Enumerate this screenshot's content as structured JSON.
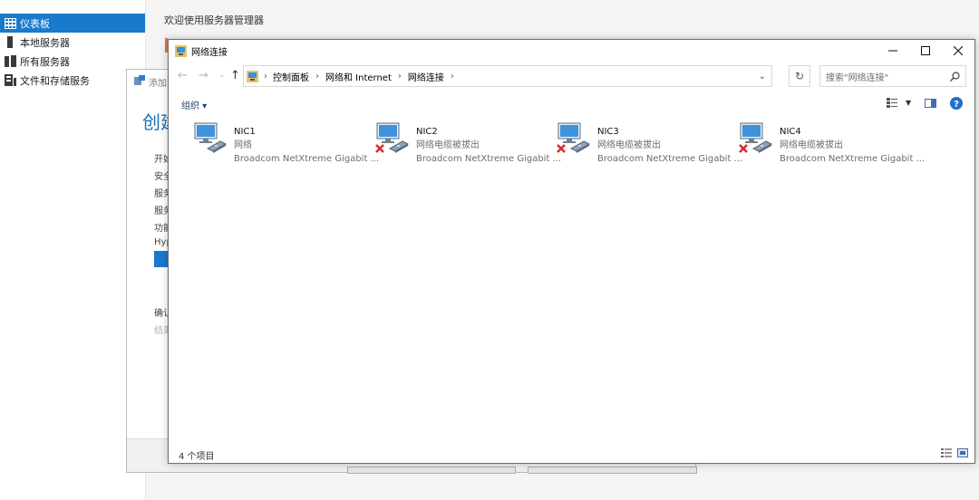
{
  "sidebar": {
    "items": [
      {
        "label": "仪表板",
        "icon": "dashboard-icon",
        "active": true
      },
      {
        "label": "本地服务器",
        "icon": "server-icon"
      },
      {
        "label": "所有服务器",
        "icon": "servers-icon"
      },
      {
        "label": "文件和存储服务",
        "icon": "storage-icon"
      }
    ]
  },
  "server_manager": {
    "welcome": "欢迎使用服务器管理器"
  },
  "wizard": {
    "title": "添加角",
    "heading": "创建",
    "nav": [
      "开始",
      "安全",
      "服务",
      "服务",
      "功能",
      "Hyp",
      "确认",
      "结果"
    ]
  },
  "explorer": {
    "title": "网络连接",
    "breadcrumb": [
      "控制面板",
      "网络和 Internet",
      "网络连接"
    ],
    "search_placeholder": "搜索\"网络连接\"",
    "organize_label": "组织 ▾",
    "adapters": [
      {
        "name": "NIC1",
        "status": "网络",
        "device": "Broadcom NetXtreme Gigabit ...",
        "disconnected": false
      },
      {
        "name": "NIC2",
        "status": "网络电缆被拔出",
        "device": "Broadcom NetXtreme Gigabit ...",
        "disconnected": true
      },
      {
        "name": "NIC3",
        "status": "网络电缆被拔出",
        "device": "Broadcom NetXtreme Gigabit ...",
        "disconnected": true
      },
      {
        "name": "NIC4",
        "status": "网络电缆被拔出",
        "device": "Broadcom NetXtreme Gigabit ...",
        "disconnected": true
      }
    ],
    "item_count": "4 个项目"
  },
  "colors": {
    "accent": "#1979ca",
    "heading_blue": "#1d6fb8",
    "error_red": "#d32f2f"
  }
}
